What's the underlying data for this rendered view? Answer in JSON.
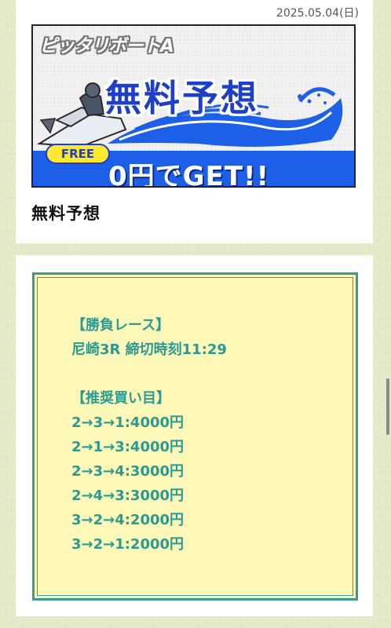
{
  "top_card": {
    "date": "2025.05.04(日)",
    "banner": {
      "brand": "ピッタリボートA",
      "title": "無料予想",
      "free_label": "FREE",
      "cta": "0円でGET!!"
    },
    "caption": "無料予想"
  },
  "forecast": {
    "race_heading": "【勝負レース】",
    "race_info": "尼崎3R 締切時刻11:29",
    "picks_heading": "【推奨買い目】",
    "picks": [
      "2→3→1:4000円",
      "2→1→3:4000円",
      "2→3→4:3000円",
      "2→4→3:3000円",
      "3→2→4:2000円",
      "3→2→1:2000円"
    ]
  },
  "colors": {
    "background": "#e6e9c9",
    "forecast_text": "#2a9a94",
    "forecast_border": "#3b9a96",
    "forecast_fill": "#fdf8b8",
    "banner_blue": "#1e3fc8"
  }
}
